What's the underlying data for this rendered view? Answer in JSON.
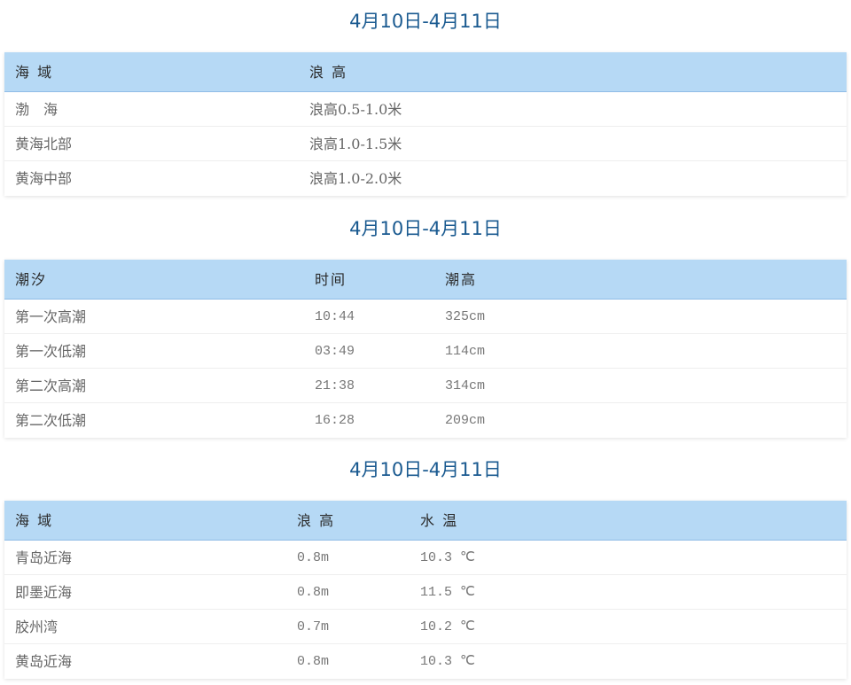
{
  "wave_section": {
    "title": "4月10日-4月11日",
    "headers": [
      "海 域",
      "浪 高"
    ],
    "rows": [
      [
        "渤　海",
        "浪高0.5-1.0米"
      ],
      [
        "黄海北部",
        "浪高1.0-1.5米"
      ],
      [
        "黄海中部",
        "浪高1.0-2.0米"
      ]
    ]
  },
  "tide_section": {
    "title": "4月10日-4月11日",
    "headers": [
      "潮汐",
      "时间",
      "潮高"
    ],
    "rows": [
      [
        "第一次高潮",
        "10:44",
        "325cm"
      ],
      [
        "第一次低潮",
        "03:49",
        "114cm"
      ],
      [
        "第二次高潮",
        "21:38",
        "314cm"
      ],
      [
        "第二次低潮",
        "16:28",
        "209cm"
      ]
    ]
  },
  "coastal_section": {
    "title": "4月10日-4月11日",
    "headers": [
      "海 域",
      "浪 高",
      "水 温"
    ],
    "rows": [
      [
        "青岛近海",
        "0.8m",
        "10.3 ℃"
      ],
      [
        "即墨近海",
        "0.8m",
        "11.5 ℃"
      ],
      [
        "胶州湾",
        "0.7m",
        "10.2 ℃"
      ],
      [
        "黄岛近海",
        "0.8m",
        "10.3 ℃"
      ]
    ]
  },
  "colors": {
    "title": "#1a5a90",
    "header_bg": "#b6d9f5",
    "header_border": "#8fbce6",
    "cell_text": "#666666"
  }
}
